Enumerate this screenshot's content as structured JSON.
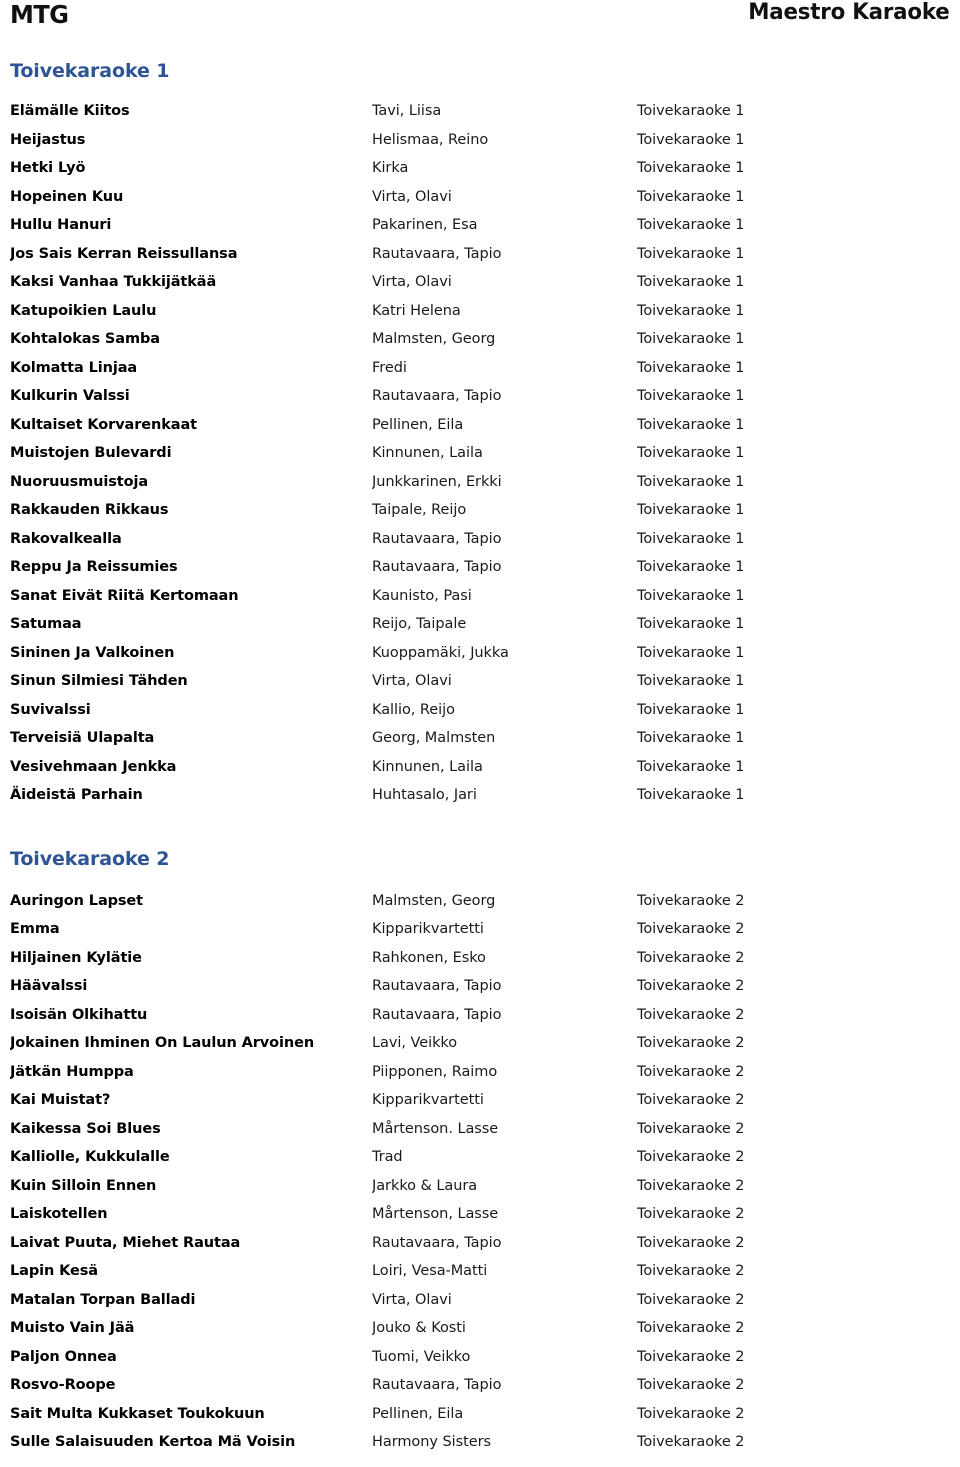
{
  "header": {
    "brand": "MTG",
    "title": "Maestro Karaoke"
  },
  "sections": [
    {
      "heading": "Toivekaraoke 1",
      "rows": [
        {
          "title": "Elämälle Kiitos",
          "artist": "Tavi, Liisa",
          "album": "Toivekaraoke 1"
        },
        {
          "title": "Heijastus",
          "artist": "Helismaa, Reino",
          "album": "Toivekaraoke 1"
        },
        {
          "title": "Hetki Lyö",
          "artist": "Kirka",
          "album": "Toivekaraoke 1"
        },
        {
          "title": "Hopeinen Kuu",
          "artist": "Virta, Olavi",
          "album": "Toivekaraoke 1"
        },
        {
          "title": "Hullu Hanuri",
          "artist": "Pakarinen, Esa",
          "album": "Toivekaraoke 1"
        },
        {
          "title": "Jos Sais Kerran Reissullansa",
          "artist": "Rautavaara, Tapio",
          "album": "Toivekaraoke 1"
        },
        {
          "title": "Kaksi Vanhaa Tukkijätkää",
          "artist": "Virta, Olavi",
          "album": "Toivekaraoke 1"
        },
        {
          "title": "Katupoikien Laulu",
          "artist": "Katri Helena",
          "album": "Toivekaraoke 1"
        },
        {
          "title": "Kohtalokas Samba",
          "artist": "Malmsten, Georg",
          "album": "Toivekaraoke 1"
        },
        {
          "title": "Kolmatta Linjaa",
          "artist": "Fredi",
          "album": "Toivekaraoke 1"
        },
        {
          "title": "Kulkurin Valssi",
          "artist": "Rautavaara, Tapio",
          "album": "Toivekaraoke 1"
        },
        {
          "title": "Kultaiset Korvarenkaat",
          "artist": "Pellinen, Eila",
          "album": "Toivekaraoke 1"
        },
        {
          "title": "Muistojen Bulevardi",
          "artist": "Kinnunen, Laila",
          "album": "Toivekaraoke 1"
        },
        {
          "title": "Nuoruusmuistoja",
          "artist": "Junkkarinen, Erkki",
          "album": "Toivekaraoke 1"
        },
        {
          "title": "Rakkauden Rikkaus",
          "artist": "Taipale, Reijo",
          "album": "Toivekaraoke 1"
        },
        {
          "title": "Rakovalkealla",
          "artist": "Rautavaara, Tapio",
          "album": "Toivekaraoke 1"
        },
        {
          "title": "Reppu Ja Reissumies",
          "artist": "Rautavaara, Tapio",
          "album": "Toivekaraoke 1"
        },
        {
          "title": "Sanat Eivät Riitä Kertomaan",
          "artist": "Kaunisto, Pasi",
          "album": "Toivekaraoke 1"
        },
        {
          "title": "Satumaa",
          "artist": "Reijo, Taipale",
          "album": "Toivekaraoke 1"
        },
        {
          "title": "Sininen Ja Valkoinen",
          "artist": "Kuoppamäki, Jukka",
          "album": "Toivekaraoke 1"
        },
        {
          "title": "Sinun Silmiesi Tähden",
          "artist": "Virta, Olavi",
          "album": "Toivekaraoke 1"
        },
        {
          "title": "Suvivalssi",
          "artist": "Kallio, Reijo",
          "album": "Toivekaraoke 1"
        },
        {
          "title": "Terveisiä Ulapalta",
          "artist": "Georg, Malmsten",
          "album": "Toivekaraoke 1"
        },
        {
          "title": "Vesivehmaan Jenkka",
          "artist": "Kinnunen, Laila",
          "album": "Toivekaraoke 1"
        },
        {
          "title": "Äideistä Parhain",
          "artist": "Huhtasalo, Jari",
          "album": "Toivekaraoke 1"
        }
      ]
    },
    {
      "heading": "Toivekaraoke 2",
      "rows": [
        {
          "title": "Auringon Lapset",
          "artist": "Malmsten, Georg",
          "album": "Toivekaraoke 2"
        },
        {
          "title": "Emma",
          "artist": "Kipparikvartetti",
          "album": "Toivekaraoke 2"
        },
        {
          "title": "Hiljainen Kylätie",
          "artist": "Rahkonen, Esko",
          "album": "Toivekaraoke 2"
        },
        {
          "title": "Häävalssi",
          "artist": "Rautavaara, Tapio",
          "album": "Toivekaraoke 2"
        },
        {
          "title": "Isoisän Olkihattu",
          "artist": "Rautavaara, Tapio",
          "album": "Toivekaraoke 2"
        },
        {
          "title": "Jokainen Ihminen On Laulun Arvoinen",
          "artist": "Lavi, Veikko",
          "album": "Toivekaraoke 2"
        },
        {
          "title": "Jätkän Humppa",
          "artist": "Piipponen, Raimo",
          "album": "Toivekaraoke 2"
        },
        {
          "title": "Kai Muistat?",
          "artist": "Kipparikvartetti",
          "album": "Toivekaraoke 2"
        },
        {
          "title": "Kaikessa Soi Blues",
          "artist": "Mårtenson. Lasse",
          "album": "Toivekaraoke 2"
        },
        {
          "title": "Kalliolle, Kukkulalle",
          "artist": "Trad",
          "album": "Toivekaraoke 2"
        },
        {
          "title": "Kuin Silloin Ennen",
          "artist": "Jarkko & Laura",
          "album": "Toivekaraoke 2"
        },
        {
          "title": "Laiskotellen",
          "artist": "Mårtenson, Lasse",
          "album": "Toivekaraoke 2"
        },
        {
          "title": "Laivat Puuta, Miehet Rautaa",
          "artist": "Rautavaara, Tapio",
          "album": "Toivekaraoke 2"
        },
        {
          "title": "Lapin Kesä",
          "artist": "Loiri, Vesa-Matti",
          "album": "Toivekaraoke 2"
        },
        {
          "title": "Matalan Torpan Balladi",
          "artist": "Virta, Olavi",
          "album": "Toivekaraoke 2"
        },
        {
          "title": "Muisto Vain Jää",
          "artist": "Jouko & Kosti",
          "album": "Toivekaraoke 2"
        },
        {
          "title": "Paljon Onnea",
          "artist": "Tuomi, Veikko",
          "album": "Toivekaraoke 2"
        },
        {
          "title": "Rosvo-Roope",
          "artist": "Rautavaara, Tapio",
          "album": "Toivekaraoke 2"
        },
        {
          "title": "Sait Multa Kukkaset Toukokuun",
          "artist": "Pellinen, Eila",
          "album": "Toivekaraoke 2"
        },
        {
          "title": "Sulle Salaisuuden Kertoa Mä Voisin",
          "artist": "Harmony Sisters",
          "album": "Toivekaraoke 2"
        }
      ]
    }
  ],
  "colors": {
    "heading": "#2e5496",
    "text": "#000000",
    "background": "#ffffff"
  }
}
